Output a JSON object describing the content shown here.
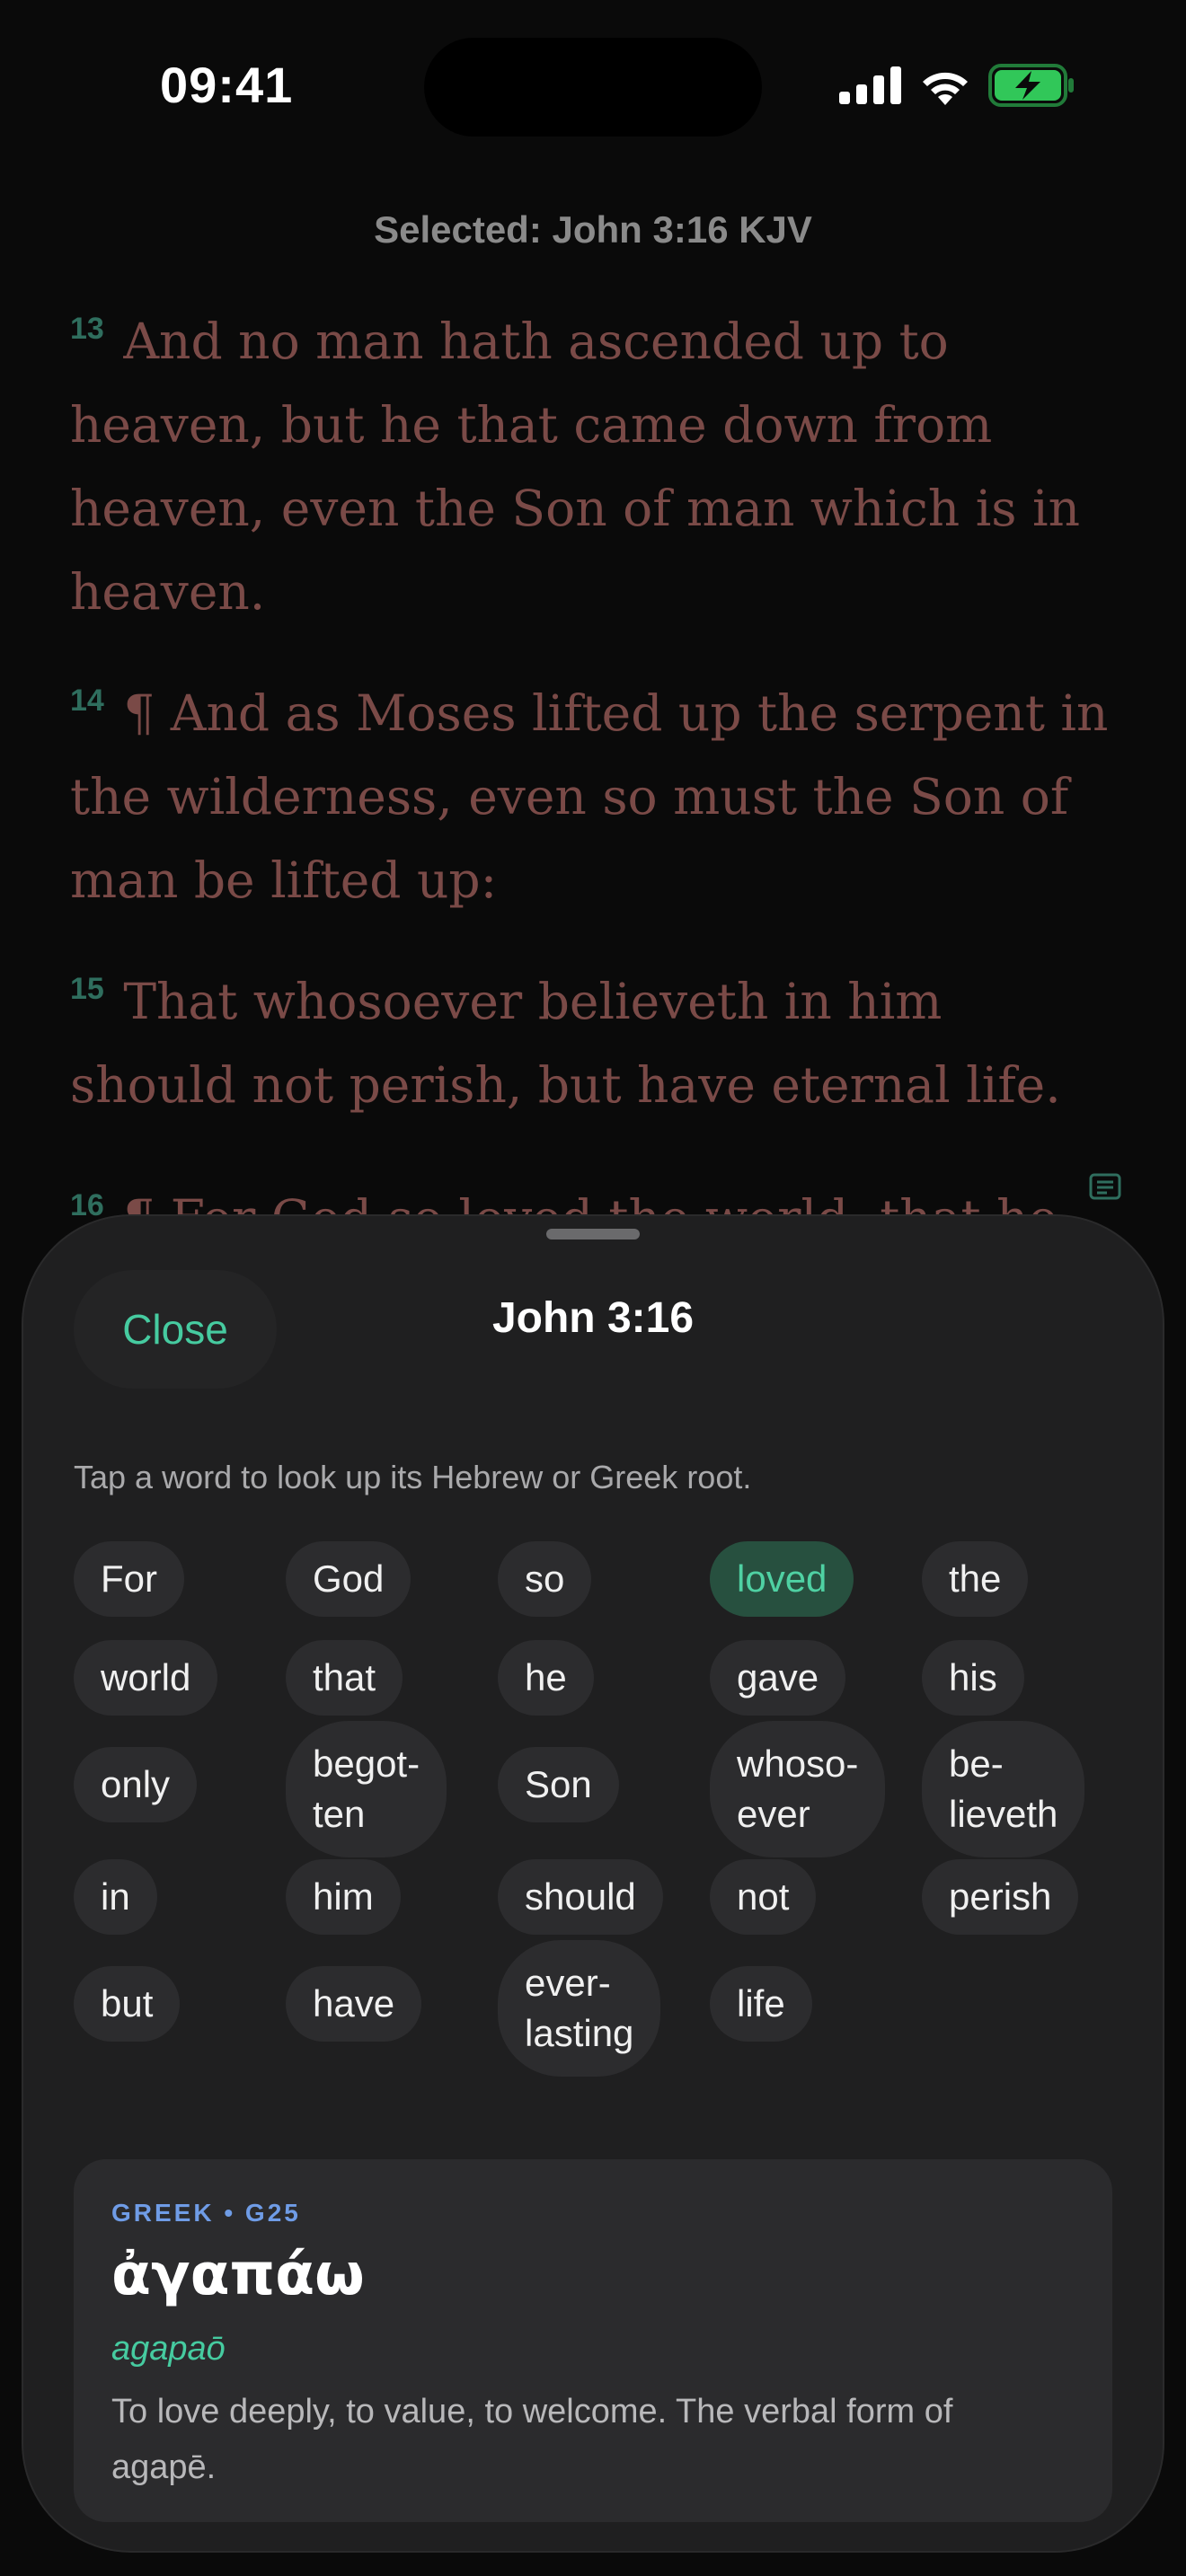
{
  "status_bar": {
    "time": "09:41",
    "icons": [
      "cellular-signal-icon",
      "wifi-icon",
      "battery-charging-icon"
    ],
    "battery_color": "#31c759"
  },
  "selection_header": "Selected: John 3:16 KJV",
  "verses": [
    {
      "number": "13",
      "text": "And no man hath ascended up to heaven, but he that came down from heaven, even the Son of man which is in heaven."
    },
    {
      "number": "14",
      "text": "¶ And as Moses lifted up the serpent in the wilderness, even so must the Son of man be lifted up:"
    },
    {
      "number": "15",
      "text": "That whosoever believeth in him should not perish, but have eternal life."
    },
    {
      "number": "16",
      "text": "¶ For God so loved the world, that he"
    }
  ],
  "note_icon": "note-icon",
  "sheet": {
    "close_label": "Close",
    "title": "John 3:16",
    "hint": "Tap a word to look up its Hebrew or Greek root.",
    "selected_word": "loved",
    "words": [
      "For",
      "God",
      "so",
      "loved",
      "the",
      "world",
      "that",
      "he",
      "gave",
      "his",
      "only",
      "begot-\nten",
      "Son",
      "whoso-\never",
      "be-\nlieveth",
      "in",
      "him",
      "should",
      "not",
      "perish",
      "but",
      "have",
      "ever-\nlasting",
      "life"
    ],
    "definition": {
      "language_label": "GREEK • G25",
      "lemma": "ἀγαπάω",
      "transliteration": "agapaō",
      "gloss": "To love deeply, to value, to welcome. The verbal form of agapē."
    }
  },
  "colors": {
    "accent": "#46cba0",
    "verse_text": "#7a4a47",
    "verse_number": "#2f6e5e",
    "sheet_bg": "#1f1f20",
    "chip_bg": "#2c2c2e",
    "chip_active_bg": "#27503f",
    "language_label": "#6f9ce6"
  }
}
